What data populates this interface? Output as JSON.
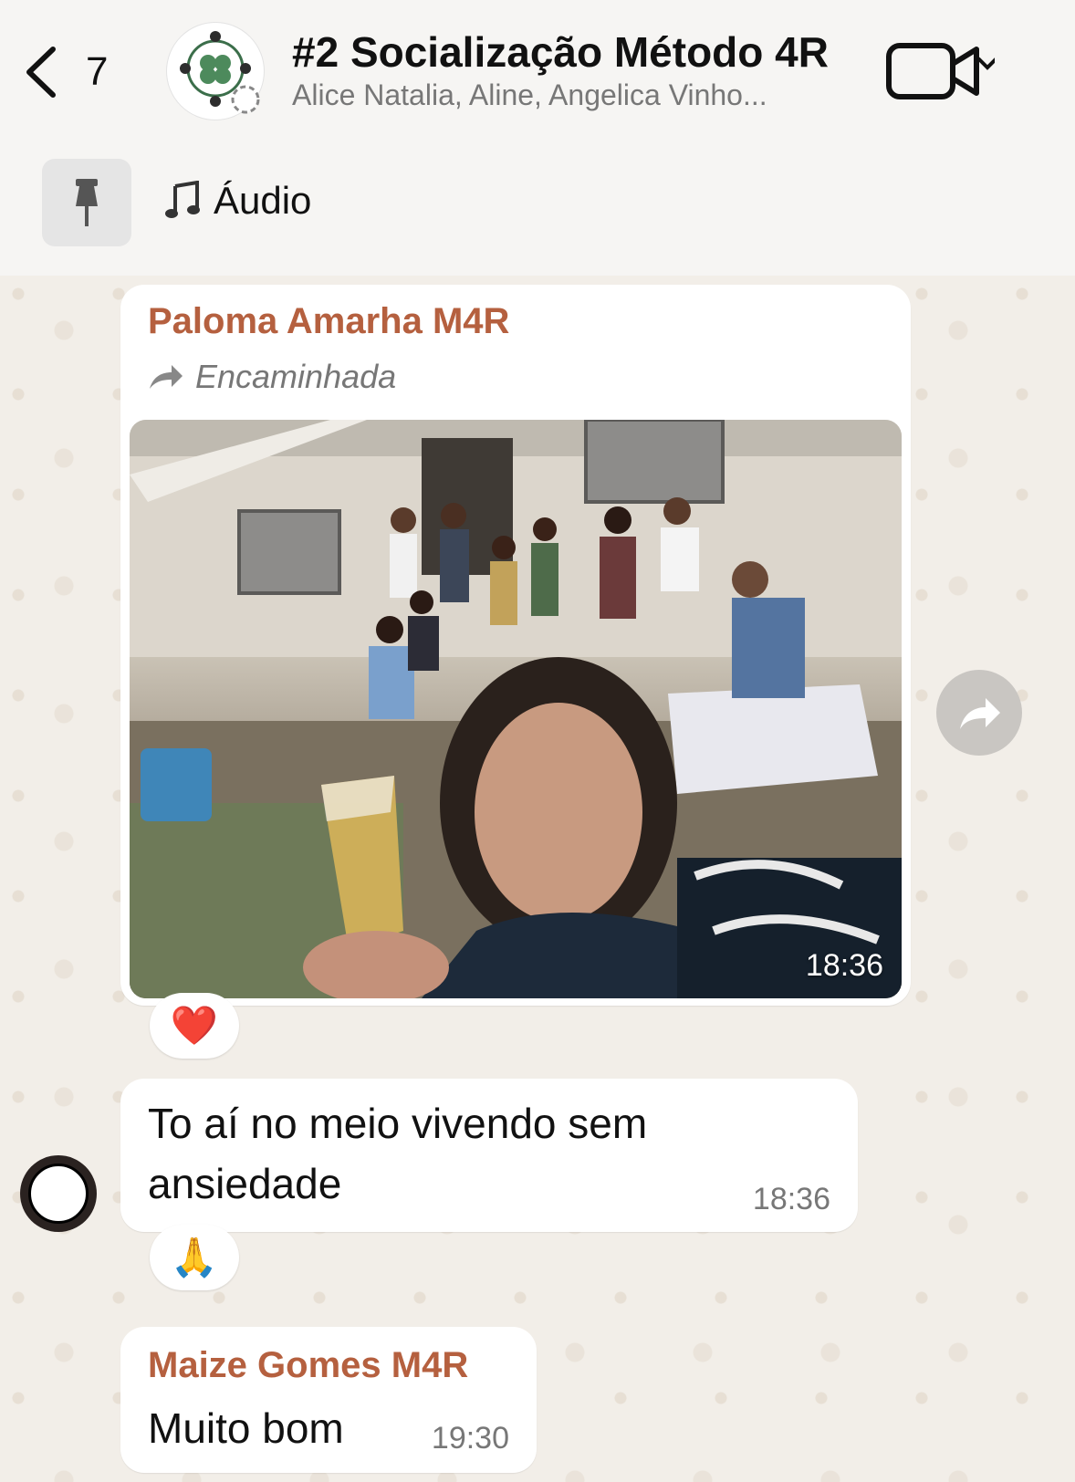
{
  "header": {
    "back_count": "7",
    "title": "#2 Socialização Método 4R",
    "subtitle": "Alice Natalia, Aline, Angelica Vinho..."
  },
  "pinned": {
    "label": "Áudio"
  },
  "messages": [
    {
      "sender": "Paloma Amarha M4R",
      "forwarded_label": "Encaminhada",
      "type": "image",
      "time": "18:36",
      "reaction": "❤️"
    },
    {
      "type": "text",
      "text": "To aí no meio vivendo sem ansiedade",
      "time": "18:36",
      "reaction": "🙏"
    },
    {
      "sender": "Maize Gomes M4R",
      "type": "text",
      "text": "Muito bom",
      "time": "19:30"
    }
  ],
  "colors": {
    "sender_name": "#b5603f",
    "chat_background": "#f2eee8",
    "bubble": "#ffffff"
  }
}
